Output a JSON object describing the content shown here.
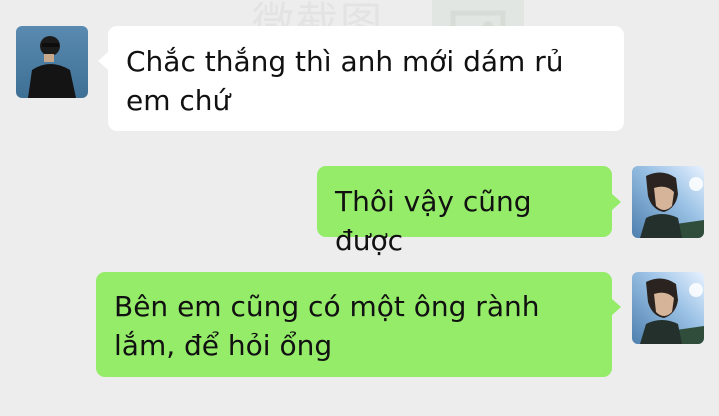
{
  "watermark": {
    "text": "微截图"
  },
  "chat": {
    "messages": [
      {
        "sender": "contact",
        "text": "Chắc thắng thì anh mới dám rủ em chứ"
      },
      {
        "sender": "me",
        "text": "Thôi vậy cũng được"
      },
      {
        "sender": "me",
        "text": "Bên em cũng có một ông rành lắm, để hỏi ổng"
      }
    ]
  },
  "colors": {
    "background": "#ededed",
    "incoming_bubble": "#ffffff",
    "outgoing_bubble": "#95ec69"
  },
  "icons": {
    "contact_avatar": "avatar-photo",
    "me_avatar": "avatar-photo",
    "watermark_logo": "image-icon"
  }
}
